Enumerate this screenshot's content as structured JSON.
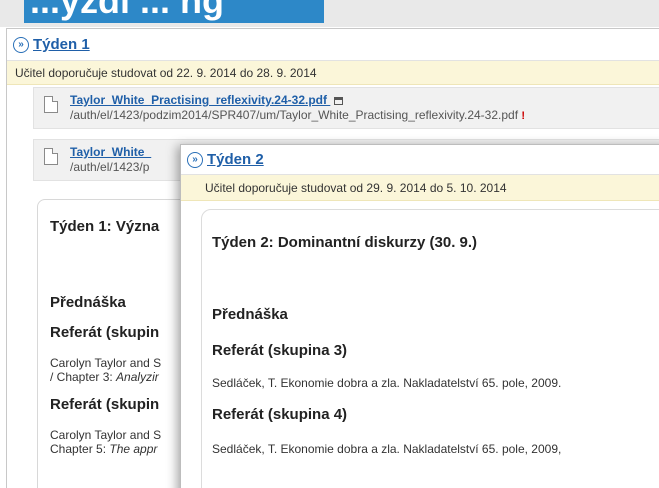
{
  "top_strip": {
    "text": "...yzdi ... ng"
  },
  "week1": {
    "title": "Týden 1",
    "note": "Učitel doporučuje studovat od 22. 9. 2014 do 28. 9. 2014",
    "files": [
      {
        "name": "Taylor_White_Practising_reflexivity.24-32.pdf",
        "path": "/auth/el/1423/podzim2014/SPR407/um/Taylor_White_Practising_reflexivity.24-32.pdf"
      },
      {
        "name": "Taylor_White_",
        "path": "/auth/el/1423/p"
      }
    ],
    "card": {
      "title": "Týden 1: Význa",
      "lecture": "Přednáška",
      "referat1": "Referát (skupin",
      "ref1_line1": "Carolyn Taylor and S",
      "ref1_line2_prefix": "/ Chapter 3: ",
      "ref1_line2_italic": "Analyzir",
      "referat2": "Referát (skupin",
      "ref2_line1": "Carolyn Taylor and S",
      "ref2_line2_prefix": "Chapter 5: ",
      "ref2_line2_italic": "The appr"
    }
  },
  "week2": {
    "title": "Týden 2",
    "note": "Učitel doporučuje studovat od 29. 9. 2014 do 5. 10. 2014",
    "card": {
      "title": "Týden 2: Dominantní diskurzy (30. 9.)",
      "lecture": "Přednáška",
      "referat3": "Referát (skupina 3)",
      "ref3": "Sedláček, T. Ekonomie dobra a zla. Nakladatelství 65. pole, 2009.",
      "referat4": "Referát (skupina 4)",
      "ref4": "Sedláček, T. Ekonomie dobra a zla. Nakladatelství 65. pole, 2009,"
    }
  },
  "icons": {
    "week_toggle": "»"
  },
  "colors": {
    "link": "#1f5fa8",
    "note_bg": "#fbf6d9",
    "strip_accent": "#2d88c8"
  }
}
